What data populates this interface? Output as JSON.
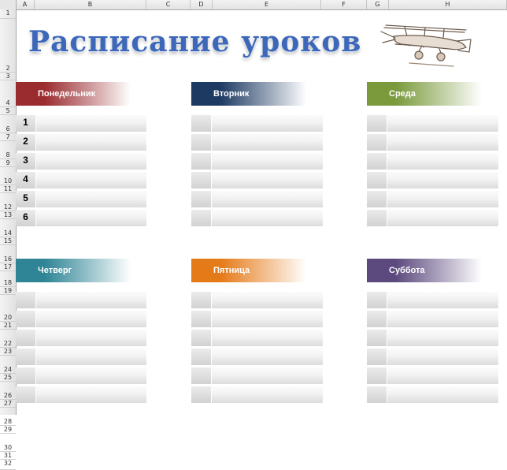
{
  "columns": [
    "A",
    "B",
    "C",
    "D",
    "E",
    "F",
    "G",
    "H"
  ],
  "rows": [
    "1",
    "2",
    "3",
    "4",
    "5",
    "6",
    "7",
    "8",
    "9",
    "10",
    "11",
    "12",
    "13",
    "14",
    "15",
    "16",
    "17",
    "18",
    "19",
    "20",
    "21",
    "22",
    "23",
    "24",
    "25",
    "26",
    "27",
    "28",
    "29",
    "30",
    "31",
    "32"
  ],
  "title": "Расписание уроков",
  "lesson_numbers": [
    "1",
    "2",
    "3",
    "4",
    "5",
    "6"
  ],
  "days": [
    {
      "name": "Понедельник",
      "color": "#9a2b2f"
    },
    {
      "name": "Вторник",
      "color": "#1d3a63"
    },
    {
      "name": "Среда",
      "color": "#7a9a3c"
    },
    {
      "name": "Четверг",
      "color": "#2f8595"
    },
    {
      "name": "Пятница",
      "color": "#e57a18"
    },
    {
      "name": "Суббота",
      "color": "#5c4a7e"
    }
  ],
  "icons": {
    "illustration": "biplane-sketch-icon"
  }
}
